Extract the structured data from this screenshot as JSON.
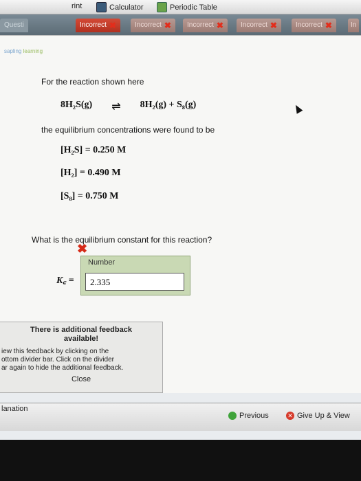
{
  "toolbar": {
    "print_label": "rint",
    "calculator_label": "Calculator",
    "periodic_table_label": "Periodic Table"
  },
  "tabs": {
    "first": "Questi",
    "items": [
      "Incorrect",
      "Incorrect",
      "Incorrect",
      "Incorrect",
      "Incorrect"
    ],
    "last": "In"
  },
  "logo": {
    "brand": "sapling",
    "suffix": "learning"
  },
  "question": {
    "intro": "For the reaction shown here",
    "reactant": "8H₂S(g)",
    "products": "8H₂(g) + S₈(g)",
    "eq_line": "the equilibrium concentrations were found to be",
    "concentrations": [
      "[H₂S] = 0.250  M",
      "[H₂] = 0.490  M",
      "[S₈] = 0.750  M"
    ],
    "prompt": "What is the equilibrium constant for this reaction?"
  },
  "answer": {
    "header": "Number",
    "k_label": "K꜀ =",
    "value": "2.335"
  },
  "feedback": {
    "title_line1": "There is additional feedback",
    "title_line2": "available!",
    "body_line1": "iew this feedback by clicking on the",
    "body_line2": "ottom divider bar. Click on the divider",
    "body_line3": "ar again to hide the additional feedback.",
    "close": "Close"
  },
  "bottom": {
    "explanation": "lanation",
    "previous": "Previous",
    "give_up": "Give Up & View"
  },
  "colors": {
    "incorrect": "#d62a18",
    "panel": "#c9d9b4"
  }
}
